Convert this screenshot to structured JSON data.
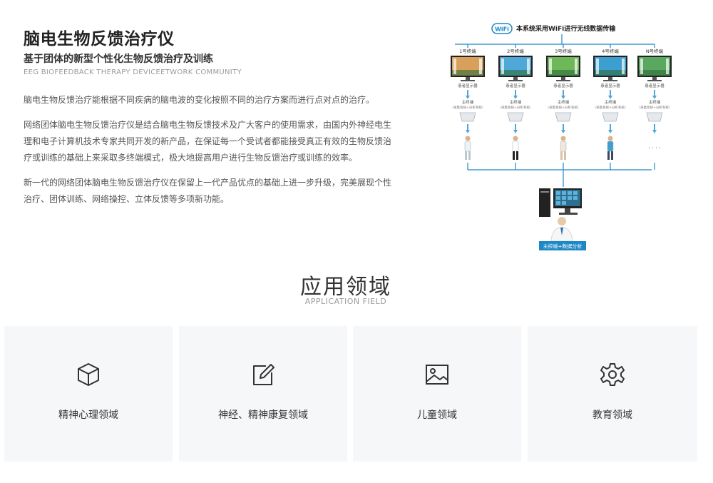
{
  "intro": {
    "title": "脑电生物反馈治疗仪",
    "subtitle": "基于团体的新型个性化生物反馈治疗及训练",
    "english": "EEG  BIOFEEDBACK THERAPY  DEVICEETWORK COMMUNITY",
    "paragraphs": [
      "脑电生物反馈治疗能根据不同疾病的脑电波的变化按照不同的治疗方案而进行点对点的治疗。",
      "网络团体脑电生物反馈治疗仪是结合脑电生物反馈技术及广大客户的使用需求，由国内外神经电生理和电子计算机技术专家共同开发的新产品，在保证每一个受试者都能接受真正有效的生物反馈治疗或训练的基础上来采取多终端模式，极大地提高用户进行生物反馈治疗或训练的效率。",
      "新一代的网络团体脑电生物反馈治疗仪在保留上一代产品优点的基础上进一步升级，完美展现个性治疗、团体训练、网络操控、立体反馈等多项新功能。"
    ]
  },
  "diagram": {
    "wifi_logo": "WiFi",
    "header": "本系统采用WiFi进行无线数据传输",
    "terminals": [
      {
        "name": "1号终端",
        "screen_label": "患者显示器",
        "device_label": "主终端",
        "device_sub": "（采集系统+分析系统）"
      },
      {
        "name": "2号终端",
        "screen_label": "患者显示器",
        "device_label": "主终端",
        "device_sub": "（采集系统+分析系统）"
      },
      {
        "name": "3号终端",
        "screen_label": "患者显示器",
        "device_label": "主终端",
        "device_sub": "（采集系统+分析系统）"
      },
      {
        "name": "4号终端",
        "screen_label": "患者显示器",
        "device_label": "主终端",
        "device_sub": "（采集系统+分析系统）"
      },
      {
        "name": "N号终端",
        "screen_label": "患者显示器",
        "device_label": "主终端",
        "device_sub": "（采集系统+分析系统）"
      }
    ],
    "ellipsis": "· · · ·",
    "master_label": "主控端+数据分析",
    "colors": {
      "line": "#1e88c7",
      "badge": "#1e88c7"
    }
  },
  "section": {
    "title": "应用领域",
    "subtitle": "APPLICATION FIELD"
  },
  "fields": [
    {
      "label": "精神心理领域",
      "icon": "cube-icon"
    },
    {
      "label": "神经、精神康复领域",
      "icon": "edit-icon"
    },
    {
      "label": "儿童领域",
      "icon": "image-icon"
    },
    {
      "label": "教育领域",
      "icon": "gear-icon"
    }
  ]
}
